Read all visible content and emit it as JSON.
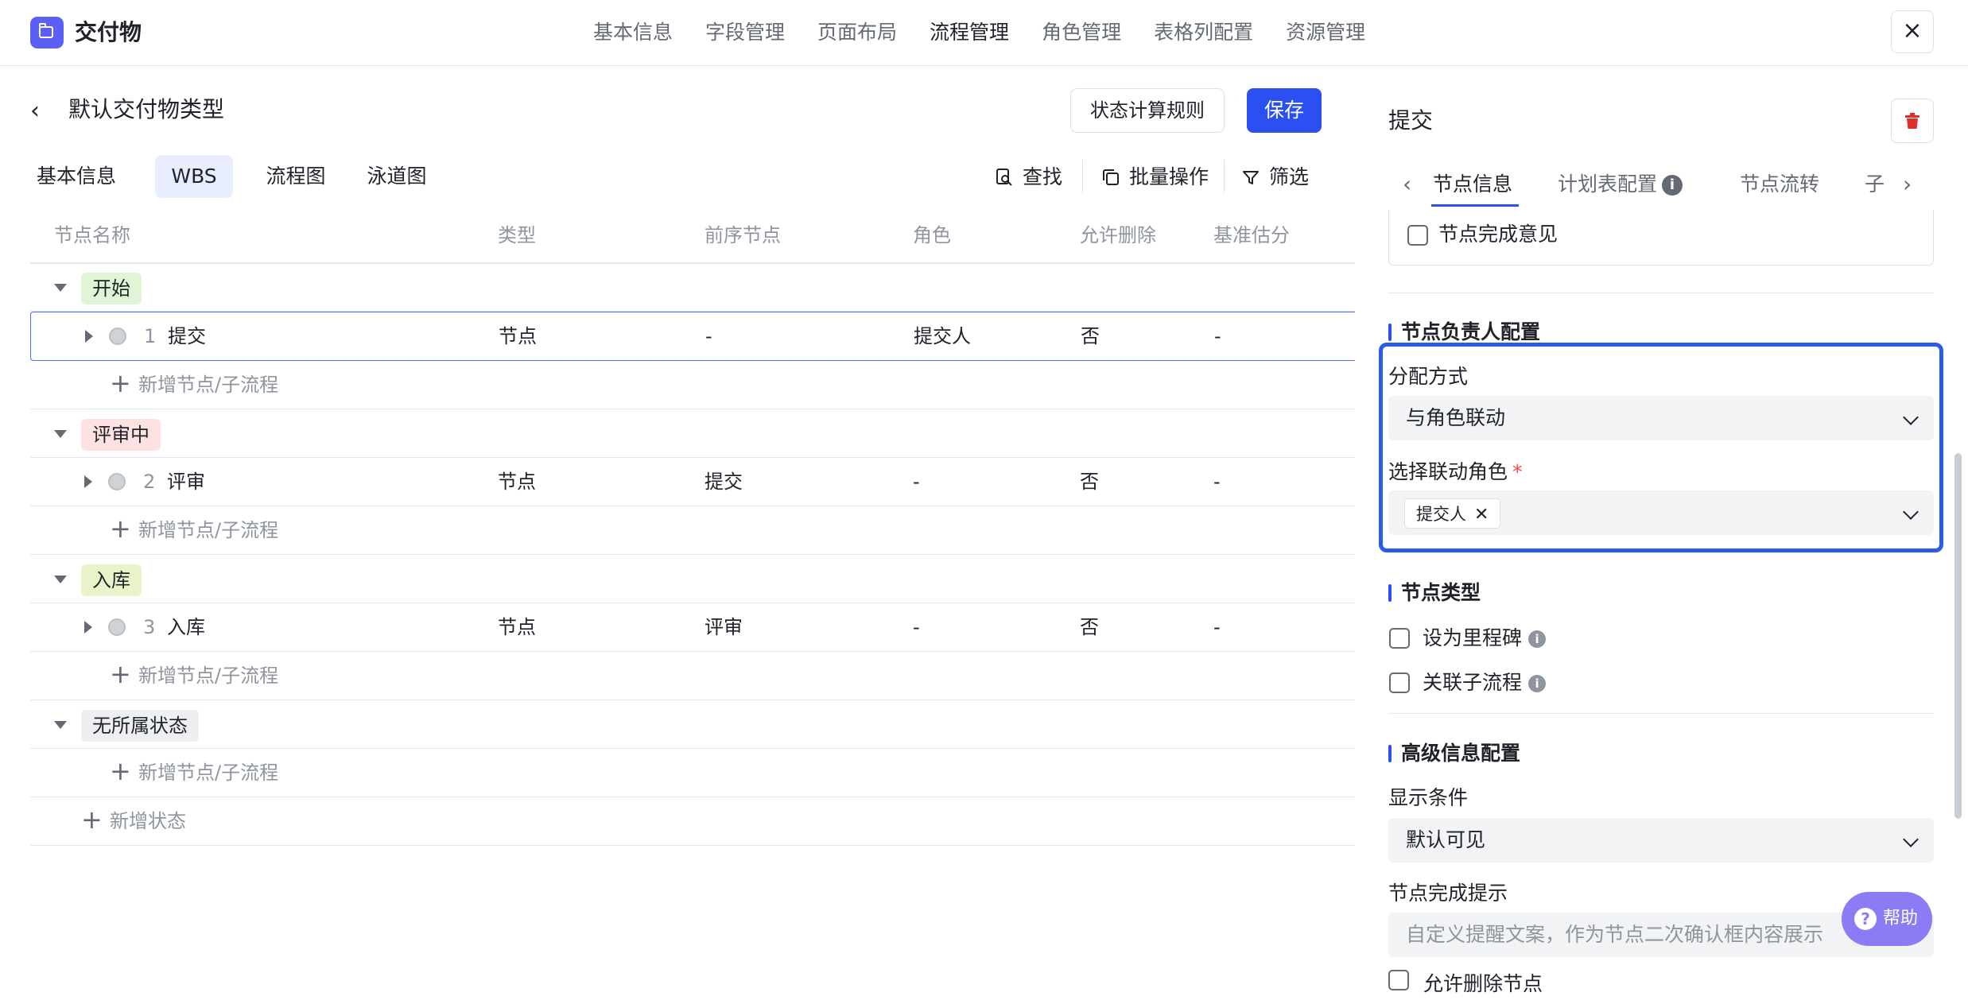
{
  "app": {
    "title": "交付物"
  },
  "top_nav": [
    "基本信息",
    "字段管理",
    "页面布局",
    "流程管理",
    "角色管理",
    "表格列配置",
    "资源管理"
  ],
  "top_nav_active": "流程管理",
  "close_icon": "×",
  "page": {
    "back_icon": "‹",
    "title": "默认交付物类型",
    "status_rule_button": "状态计算规则",
    "save_button": "保存"
  },
  "view_tabs": [
    "基本信息",
    "WBS",
    "流程图",
    "泳道图"
  ],
  "view_tab_active": "WBS",
  "toolbar": {
    "find": "查找",
    "batch": "批量操作",
    "filter": "筛选"
  },
  "table": {
    "headers": [
      "节点名称",
      "类型",
      "前序节点",
      "角色",
      "允许删除",
      "基准估分"
    ],
    "add_node_label": "新增节点/子流程",
    "add_status_label": "新增状态",
    "groups": [
      {
        "status": "开始",
        "color": "#dff5d6",
        "node": {
          "index": "1",
          "name": "提交",
          "type": "节点",
          "prev": "-",
          "role": "提交人",
          "deletable": "否",
          "estimate": "-"
        }
      },
      {
        "status": "评审中",
        "color": "#fde2e1",
        "node": {
          "index": "2",
          "name": "评审",
          "type": "节点",
          "prev": "提交",
          "role": "-",
          "deletable": "否",
          "estimate": "-"
        }
      },
      {
        "status": "入库",
        "color": "#e9f3c9",
        "node": {
          "index": "3",
          "name": "入库",
          "type": "节点",
          "prev": "评审",
          "role": "-",
          "deletable": "否",
          "estimate": "-"
        }
      },
      {
        "status": "无所属状态",
        "color": "#eeeff1"
      }
    ]
  },
  "panel": {
    "title": "提交",
    "tabs": [
      "节点信息",
      "计划表配置",
      "节点流转",
      "子"
    ],
    "tab_active": "节点信息",
    "tab_info_icon": "i",
    "node_complete_opinion": "节点完成意见",
    "owner_section": "节点负责人配置",
    "assign_label": "分配方式",
    "assign_value": "与角色联动",
    "role_label": "选择联动角色",
    "required_mark": "*",
    "role_chip": "提交人",
    "chip_remove": "✕",
    "node_type_section": "节点类型",
    "milestone_label": "设为里程碑",
    "subflow_label": "关联子流程",
    "advanced_section": "高级信息配置",
    "display_label": "显示条件",
    "display_value": "默认可见",
    "hint_label": "节点完成提示",
    "hint_placeholder": "自定义提醒文案，作为节点二次确认框内容展示",
    "partial_text": "允许删除节点"
  },
  "help": {
    "label": "帮助",
    "icon": "?"
  }
}
